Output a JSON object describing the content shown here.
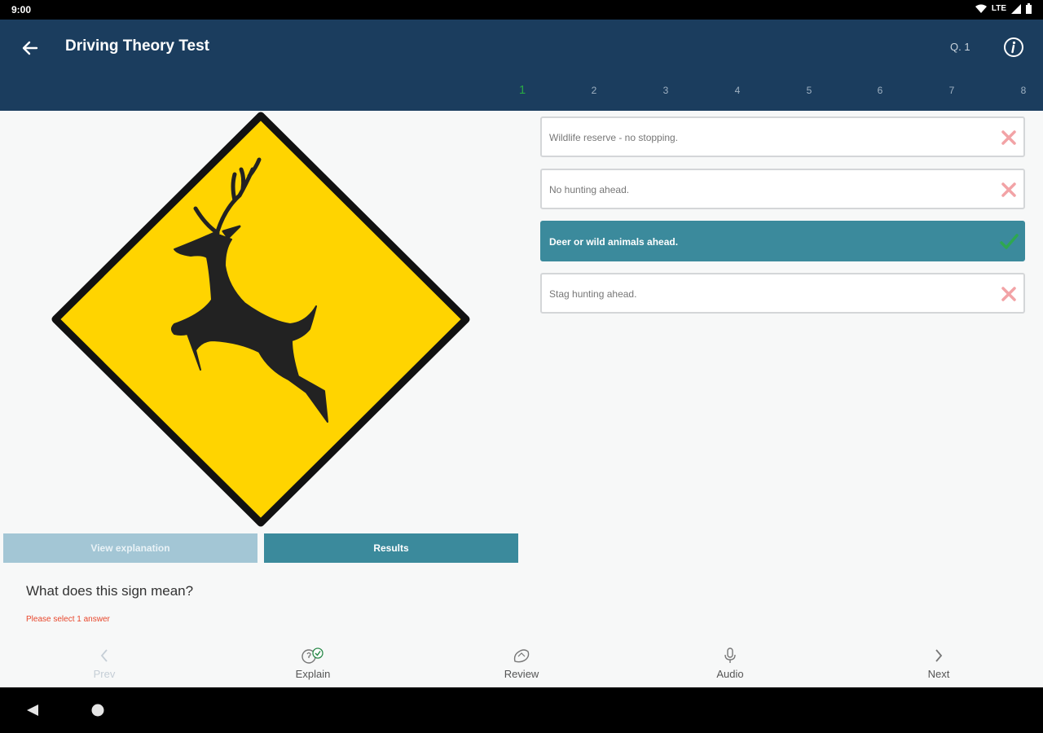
{
  "status_bar": {
    "time": "9:00",
    "network": "LTE"
  },
  "app_bar": {
    "title": "Driving Theory Test",
    "question_label": "Q. 1"
  },
  "tabs": [
    "1",
    "2",
    "3",
    "4",
    "5",
    "6",
    "7",
    "8"
  ],
  "active_tab": "1",
  "buttons": {
    "view_explanation": "View explanation",
    "results": "Results"
  },
  "question": {
    "text": "What does this sign mean?",
    "hint": "Please select 1 answer"
  },
  "answers": [
    {
      "text": "Wildlife reserve - no stopping.",
      "state": "wrong"
    },
    {
      "text": "No hunting ahead.",
      "state": "wrong"
    },
    {
      "text": "Deer or wild animals ahead.",
      "state": "correct"
    },
    {
      "text": "Stag hunting ahead.",
      "state": "wrong"
    }
  ],
  "bottom_nav": {
    "prev": "Prev",
    "explain": "Explain",
    "review": "Review",
    "audio": "Audio",
    "next": "Next"
  },
  "colors": {
    "app_bar": "#1b3d5e",
    "accent": "#3b8a9c",
    "sign_yellow": "#ffd400",
    "correct_check": "#2ea84f",
    "wrong_mark": "#f2a3a6",
    "hint": "#e8472c"
  },
  "icons": {
    "back": "arrow-left-icon",
    "info": "info-icon",
    "wrong": "cross-icon",
    "correct": "checkmark-icon",
    "prev": "chevron-left-icon",
    "explain": "explain-icon",
    "review": "review-icon",
    "audio": "microphone-icon",
    "next": "chevron-right-icon"
  }
}
